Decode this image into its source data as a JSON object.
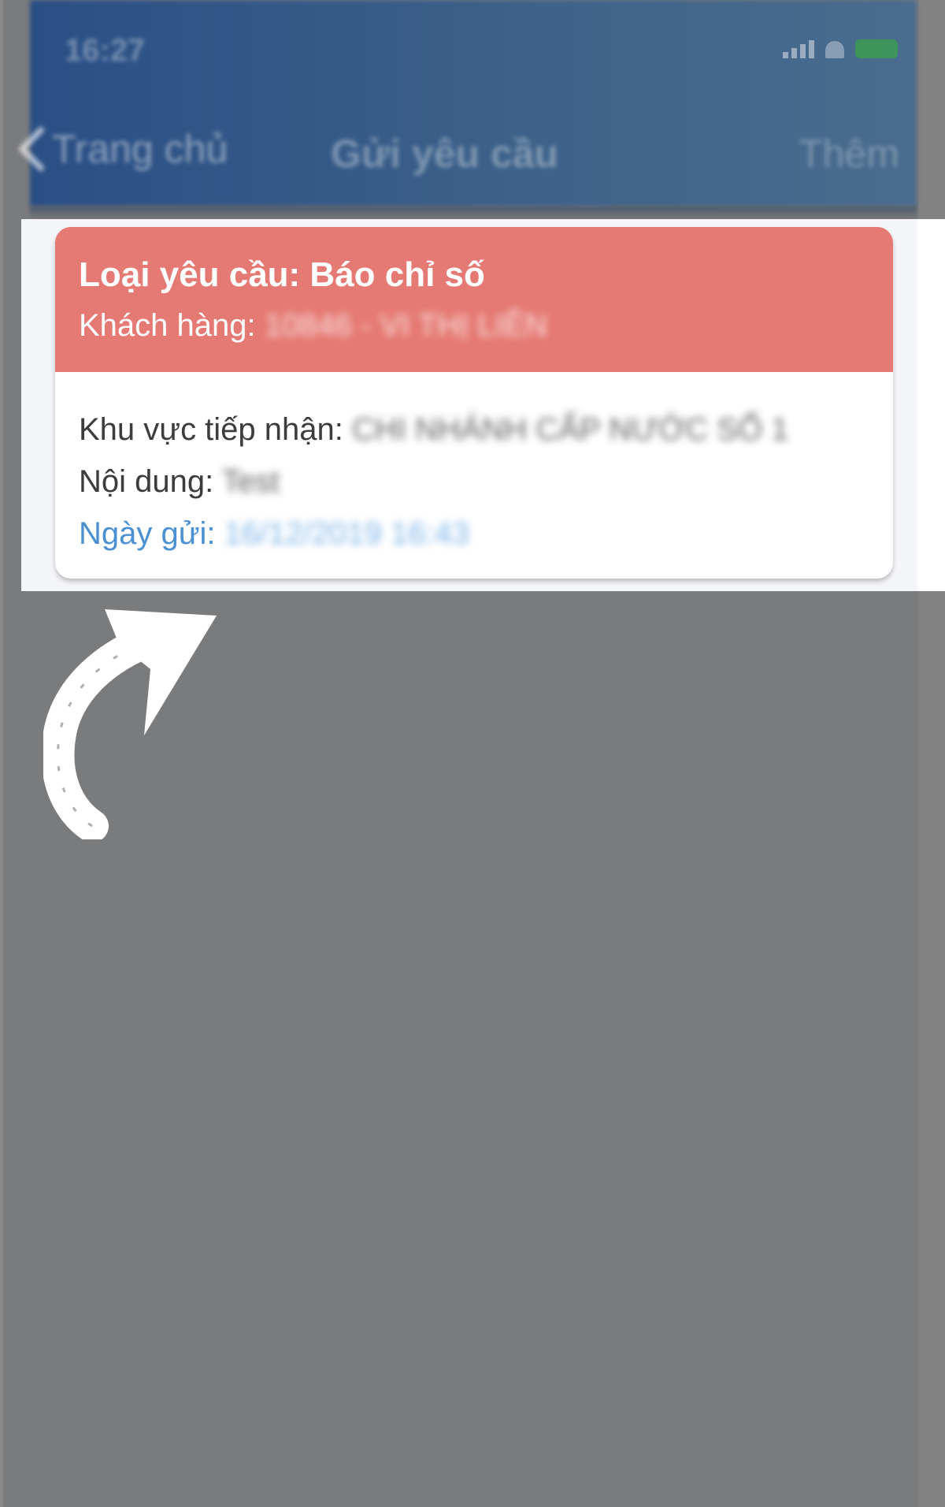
{
  "status_bar": {
    "time": "16:27",
    "icons": [
      "signal-icon",
      "wifi-icon",
      "battery-icon"
    ]
  },
  "navbar": {
    "back_label": "Trang chủ",
    "title": "Gửi yêu cầu",
    "more_label": "Thêm"
  },
  "card": {
    "title": "Loại yêu cầu: Báo chỉ số",
    "customer_label": "Khách hàng:",
    "customer_value": "10846 - VI THỊ LIÊN",
    "area_label": "Khu vực tiếp nhận:",
    "area_value": "CHI NHÁNH CẤP NƯỚC SỐ 1",
    "content_label": "Nội dung:",
    "content_value": "Test",
    "date_label": "Ngày gửi:",
    "date_value": "16/12/2019 16:43"
  },
  "colors": {
    "navbar": "#2a4f85",
    "card_header": "#e57973",
    "date_text": "#4a90d2",
    "overlay": "#7a7b7d"
  }
}
